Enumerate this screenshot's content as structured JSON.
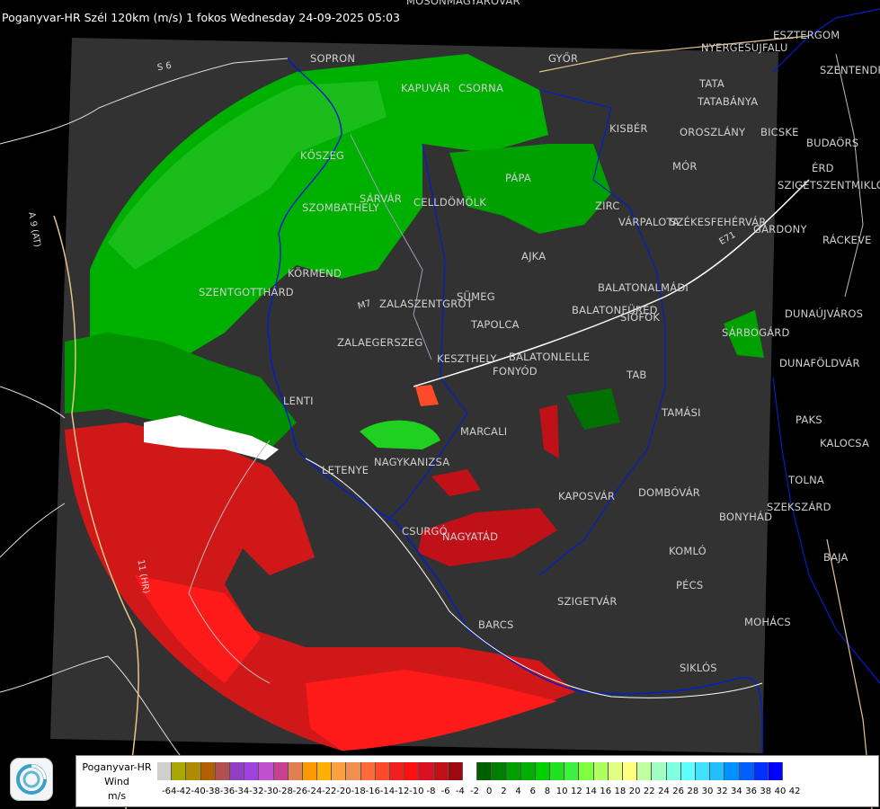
{
  "header": {
    "title": "Poganyvar-HR Szél 120km (m/s) 1 fokos Wednesday 24-09-2025 05:03"
  },
  "legend": {
    "name_line1": "Poganyvar-HR",
    "name_line2": "Wind",
    "name_line3": "m/s",
    "ticks": [
      "-64",
      "-42",
      "-40",
      "-38",
      "-36",
      "-34",
      "-32",
      "-30",
      "-28",
      "-26",
      "-24",
      "-22",
      "-20",
      "-18",
      "-16",
      "-14",
      "-12",
      "-10",
      "-8",
      "-6",
      "-4",
      "-2",
      "0",
      "2",
      "4",
      "6",
      "8",
      "10",
      "12",
      "14",
      "16",
      "18",
      "20",
      "22",
      "24",
      "26",
      "28",
      "30",
      "32",
      "34",
      "36",
      "38",
      "40",
      "42"
    ],
    "colors": [
      "#cfcfcf",
      "#a8a800",
      "#b08a00",
      "#b06000",
      "#b05050",
      "#9040c0",
      "#a040e0",
      "#c050d0",
      "#c84090",
      "#e08050",
      "#ff9900",
      "#ffb000",
      "#ffa040",
      "#f09050",
      "#ff6a3a",
      "#ff4a2a",
      "#f02020",
      "#ff1010",
      "#d81020",
      "#c01018",
      "#a00810",
      "#ffffff",
      "#006000",
      "#008000",
      "#00a000",
      "#00b000",
      "#00d000",
      "#20e020",
      "#40f040",
      "#80ff40",
      "#b0ff60",
      "#e0ff80",
      "#ffff80",
      "#c0ffa0",
      "#a0ffc0",
      "#80ffe0",
      "#60ffff",
      "#40e0ff",
      "#20c0ff",
      "#0090ff",
      "#0060ff",
      "#0030ff",
      "#0000ff"
    ]
  },
  "cities": [
    {
      "name": "SOPRON"
    },
    {
      "name": "GYŐR"
    },
    {
      "name": "KAPUVÁR"
    },
    {
      "name": "CSORNA"
    },
    {
      "name": "MOSONMAGYARÓVÁR"
    },
    {
      "name": "TATA"
    },
    {
      "name": "TATABÁNYA"
    },
    {
      "name": "ESZTERGOM"
    },
    {
      "name": "NYERGESÚJFALU"
    },
    {
      "name": "SZENTENDRE"
    },
    {
      "name": "KISBÉR"
    },
    {
      "name": "OROSZLÁNY"
    },
    {
      "name": "BICSKE"
    },
    {
      "name": "BUDAÖRS"
    },
    {
      "name": "MÓR"
    },
    {
      "name": "ÉRD"
    },
    {
      "name": "SZIGETSZENTMIKLÓS"
    },
    {
      "name": "KŐSZEG"
    },
    {
      "name": "PÁPA"
    },
    {
      "name": "SZOMBATHELY"
    },
    {
      "name": "SÁRVÁR"
    },
    {
      "name": "CELLDÖMÖLK"
    },
    {
      "name": "ZIRC"
    },
    {
      "name": "VÁRPALOTA"
    },
    {
      "name": "SZÉKESFEHÉRVÁR"
    },
    {
      "name": "GÁRDONY"
    },
    {
      "name": "RÁCKEVE"
    },
    {
      "name": "AJKA"
    },
    {
      "name": "KÖRMEND"
    },
    {
      "name": "SZENTGOTTHÁRD"
    },
    {
      "name": "SÜMEG"
    },
    {
      "name": "ZALASZENTGRÓT"
    },
    {
      "name": "BALATONALMÁDI"
    },
    {
      "name": "BALATONFÜRED"
    },
    {
      "name": "SIÓFOK"
    },
    {
      "name": "TAPOLCA"
    },
    {
      "name": "ZALAEGERSZEG"
    },
    {
      "name": "DUNAÚJVÁROS"
    },
    {
      "name": "SÁRBOGÁRD"
    },
    {
      "name": "KESZTHELY"
    },
    {
      "name": "BALATONLELLE"
    },
    {
      "name": "FONYÓD"
    },
    {
      "name": "DUNAFÖLDVÁR"
    },
    {
      "name": "TAB"
    },
    {
      "name": "LENTI"
    },
    {
      "name": "TAMÁSI"
    },
    {
      "name": "PAKS"
    },
    {
      "name": "MARCALI"
    },
    {
      "name": "KALOCSA"
    },
    {
      "name": "LETENYE"
    },
    {
      "name": "NAGYKANIZSA"
    },
    {
      "name": "TOLNA"
    },
    {
      "name": "KAPOSVÁR"
    },
    {
      "name": "DOMBÓVÁR"
    },
    {
      "name": "SZEKSZÁRD"
    },
    {
      "name": "CSURGÓ"
    },
    {
      "name": "NAGYATÁD"
    },
    {
      "name": "BONYHÁD"
    },
    {
      "name": "KOMLÓ"
    },
    {
      "name": "BAJA"
    },
    {
      "name": "PÉCS"
    },
    {
      "name": "SZIGETVÁR"
    },
    {
      "name": "MOHÁCS"
    },
    {
      "name": "BARCS"
    },
    {
      "name": "SIKLÓS"
    }
  ],
  "roads": [
    {
      "name": "S 6"
    },
    {
      "name": "A 9 (AT)"
    },
    {
      "name": "M7"
    },
    {
      "name": "E71"
    },
    {
      "name": "11 (HR)"
    }
  ]
}
